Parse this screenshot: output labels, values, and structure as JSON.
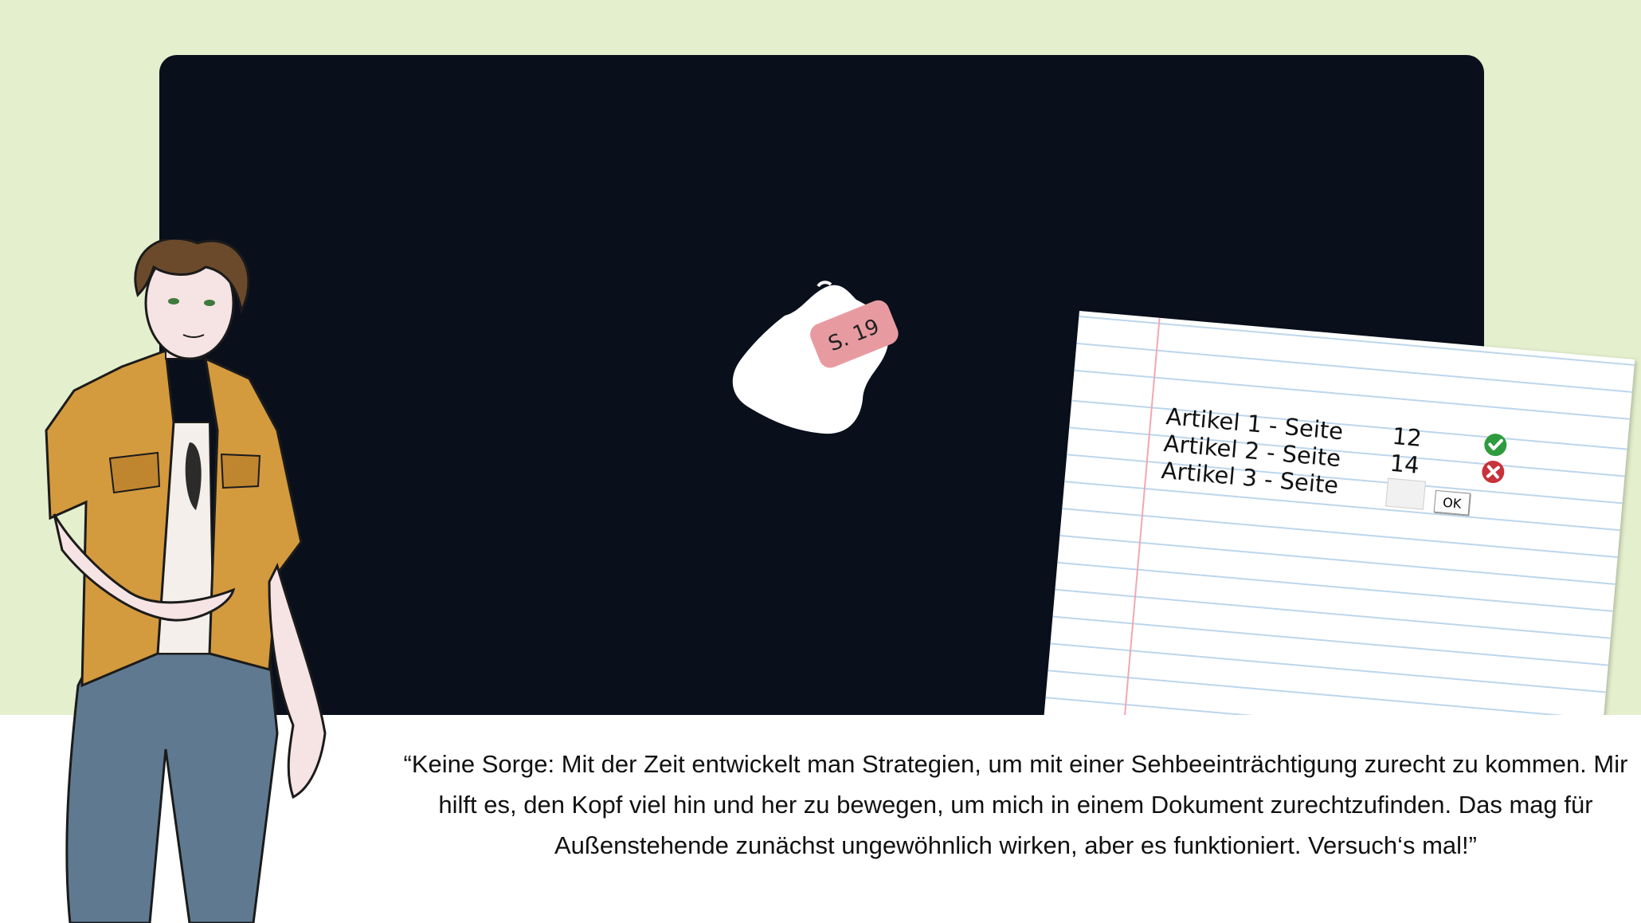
{
  "page_number_tag": "S. 19",
  "notebook": {
    "rows": [
      {
        "label": "Artikel 1 - Seite",
        "value": "12",
        "status": "correct"
      },
      {
        "label": "Artikel 2 - Seite",
        "value": "14",
        "status": "incorrect"
      },
      {
        "label": "Artikel 3 - Seite",
        "value": "",
        "status": "pending"
      }
    ],
    "answer_input_value": "",
    "ok_label": "OK"
  },
  "caption": "“Keine Sorge: Mit der Zeit entwickelt man Strategien, um mit einer Sehbeeinträchtigung zurecht zu kommen. Mir hilft es, den Kopf viel hin und her zu bewegen, um mich in einem Dokument zurechtzufinden. Das mag für Außenstehende zunächst ungewöhnlich wirken, aber es funktioniert. Versuch‘s mal!”",
  "colors": {
    "background": "#e4efcd",
    "screen": "#0a0f1c",
    "tag": "#e79ba1",
    "correct": "#2f9b3f",
    "incorrect": "#c8323a",
    "jacket": "#d49a3e",
    "jeans": "#5f7a90"
  },
  "icons": [
    "check-circle-icon",
    "cross-circle-icon"
  ]
}
